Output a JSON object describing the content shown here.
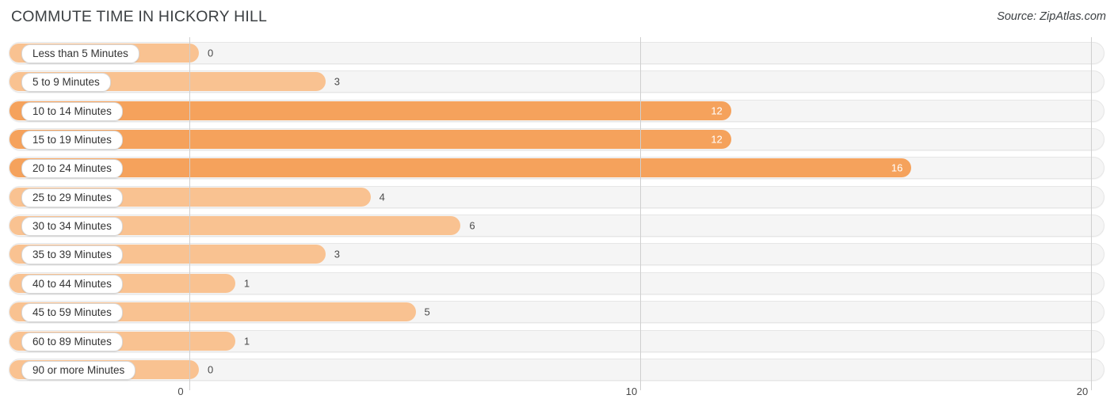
{
  "header": {
    "title": "COMMUTE TIME IN HICKORY HILL",
    "source": "Source: ZipAtlas.com"
  },
  "colors": {
    "bar_light": "#f9c291",
    "bar_dark": "#f5a25c",
    "track": "#f5f5f5",
    "gridline": "#cfcfcf",
    "title_text": "#3c4043"
  },
  "chart_data": {
    "type": "bar",
    "orientation": "horizontal",
    "title": "COMMUTE TIME IN HICKORY HILL",
    "xlabel": "",
    "ylabel": "",
    "xlim": [
      0,
      20
    ],
    "grid": true,
    "legend": false,
    "xticks": [
      "0",
      "10",
      "20"
    ],
    "xtick_values": [
      0,
      10,
      20
    ],
    "categories": [
      "Less than 5 Minutes",
      "5 to 9 Minutes",
      "10 to 14 Minutes",
      "15 to 19 Minutes",
      "20 to 24 Minutes",
      "25 to 29 Minutes",
      "30 to 34 Minutes",
      "35 to 39 Minutes",
      "40 to 44 Minutes",
      "45 to 59 Minutes",
      "60 to 89 Minutes",
      "90 or more Minutes"
    ],
    "values": [
      0,
      3,
      12,
      12,
      16,
      4,
      6,
      3,
      1,
      5,
      1,
      0
    ],
    "value_labels": [
      "0",
      "3",
      "12",
      "12",
      "16",
      "4",
      "6",
      "3",
      "1",
      "5",
      "1",
      "0"
    ]
  },
  "rows": [
    {
      "label": "Less than 5 Minutes",
      "value": 0,
      "value_label": "0",
      "shade": "light",
      "inside": false
    },
    {
      "label": "5 to 9 Minutes",
      "value": 3,
      "value_label": "3",
      "shade": "light",
      "inside": false
    },
    {
      "label": "10 to 14 Minutes",
      "value": 12,
      "value_label": "12",
      "shade": "dark",
      "inside": true
    },
    {
      "label": "15 to 19 Minutes",
      "value": 12,
      "value_label": "12",
      "shade": "dark",
      "inside": true
    },
    {
      "label": "20 to 24 Minutes",
      "value": 16,
      "value_label": "16",
      "shade": "dark",
      "inside": true
    },
    {
      "label": "25 to 29 Minutes",
      "value": 4,
      "value_label": "4",
      "shade": "light",
      "inside": false
    },
    {
      "label": "30 to 34 Minutes",
      "value": 6,
      "value_label": "6",
      "shade": "light",
      "inside": false
    },
    {
      "label": "35 to 39 Minutes",
      "value": 3,
      "value_label": "3",
      "shade": "light",
      "inside": false
    },
    {
      "label": "40 to 44 Minutes",
      "value": 1,
      "value_label": "1",
      "shade": "light",
      "inside": false
    },
    {
      "label": "45 to 59 Minutes",
      "value": 5,
      "value_label": "5",
      "shade": "light",
      "inside": false
    },
    {
      "label": "60 to 89 Minutes",
      "value": 1,
      "value_label": "1",
      "shade": "light",
      "inside": false
    },
    {
      "label": "90 or more Minutes",
      "value": 0,
      "value_label": "0",
      "shade": "light",
      "inside": false
    }
  ]
}
